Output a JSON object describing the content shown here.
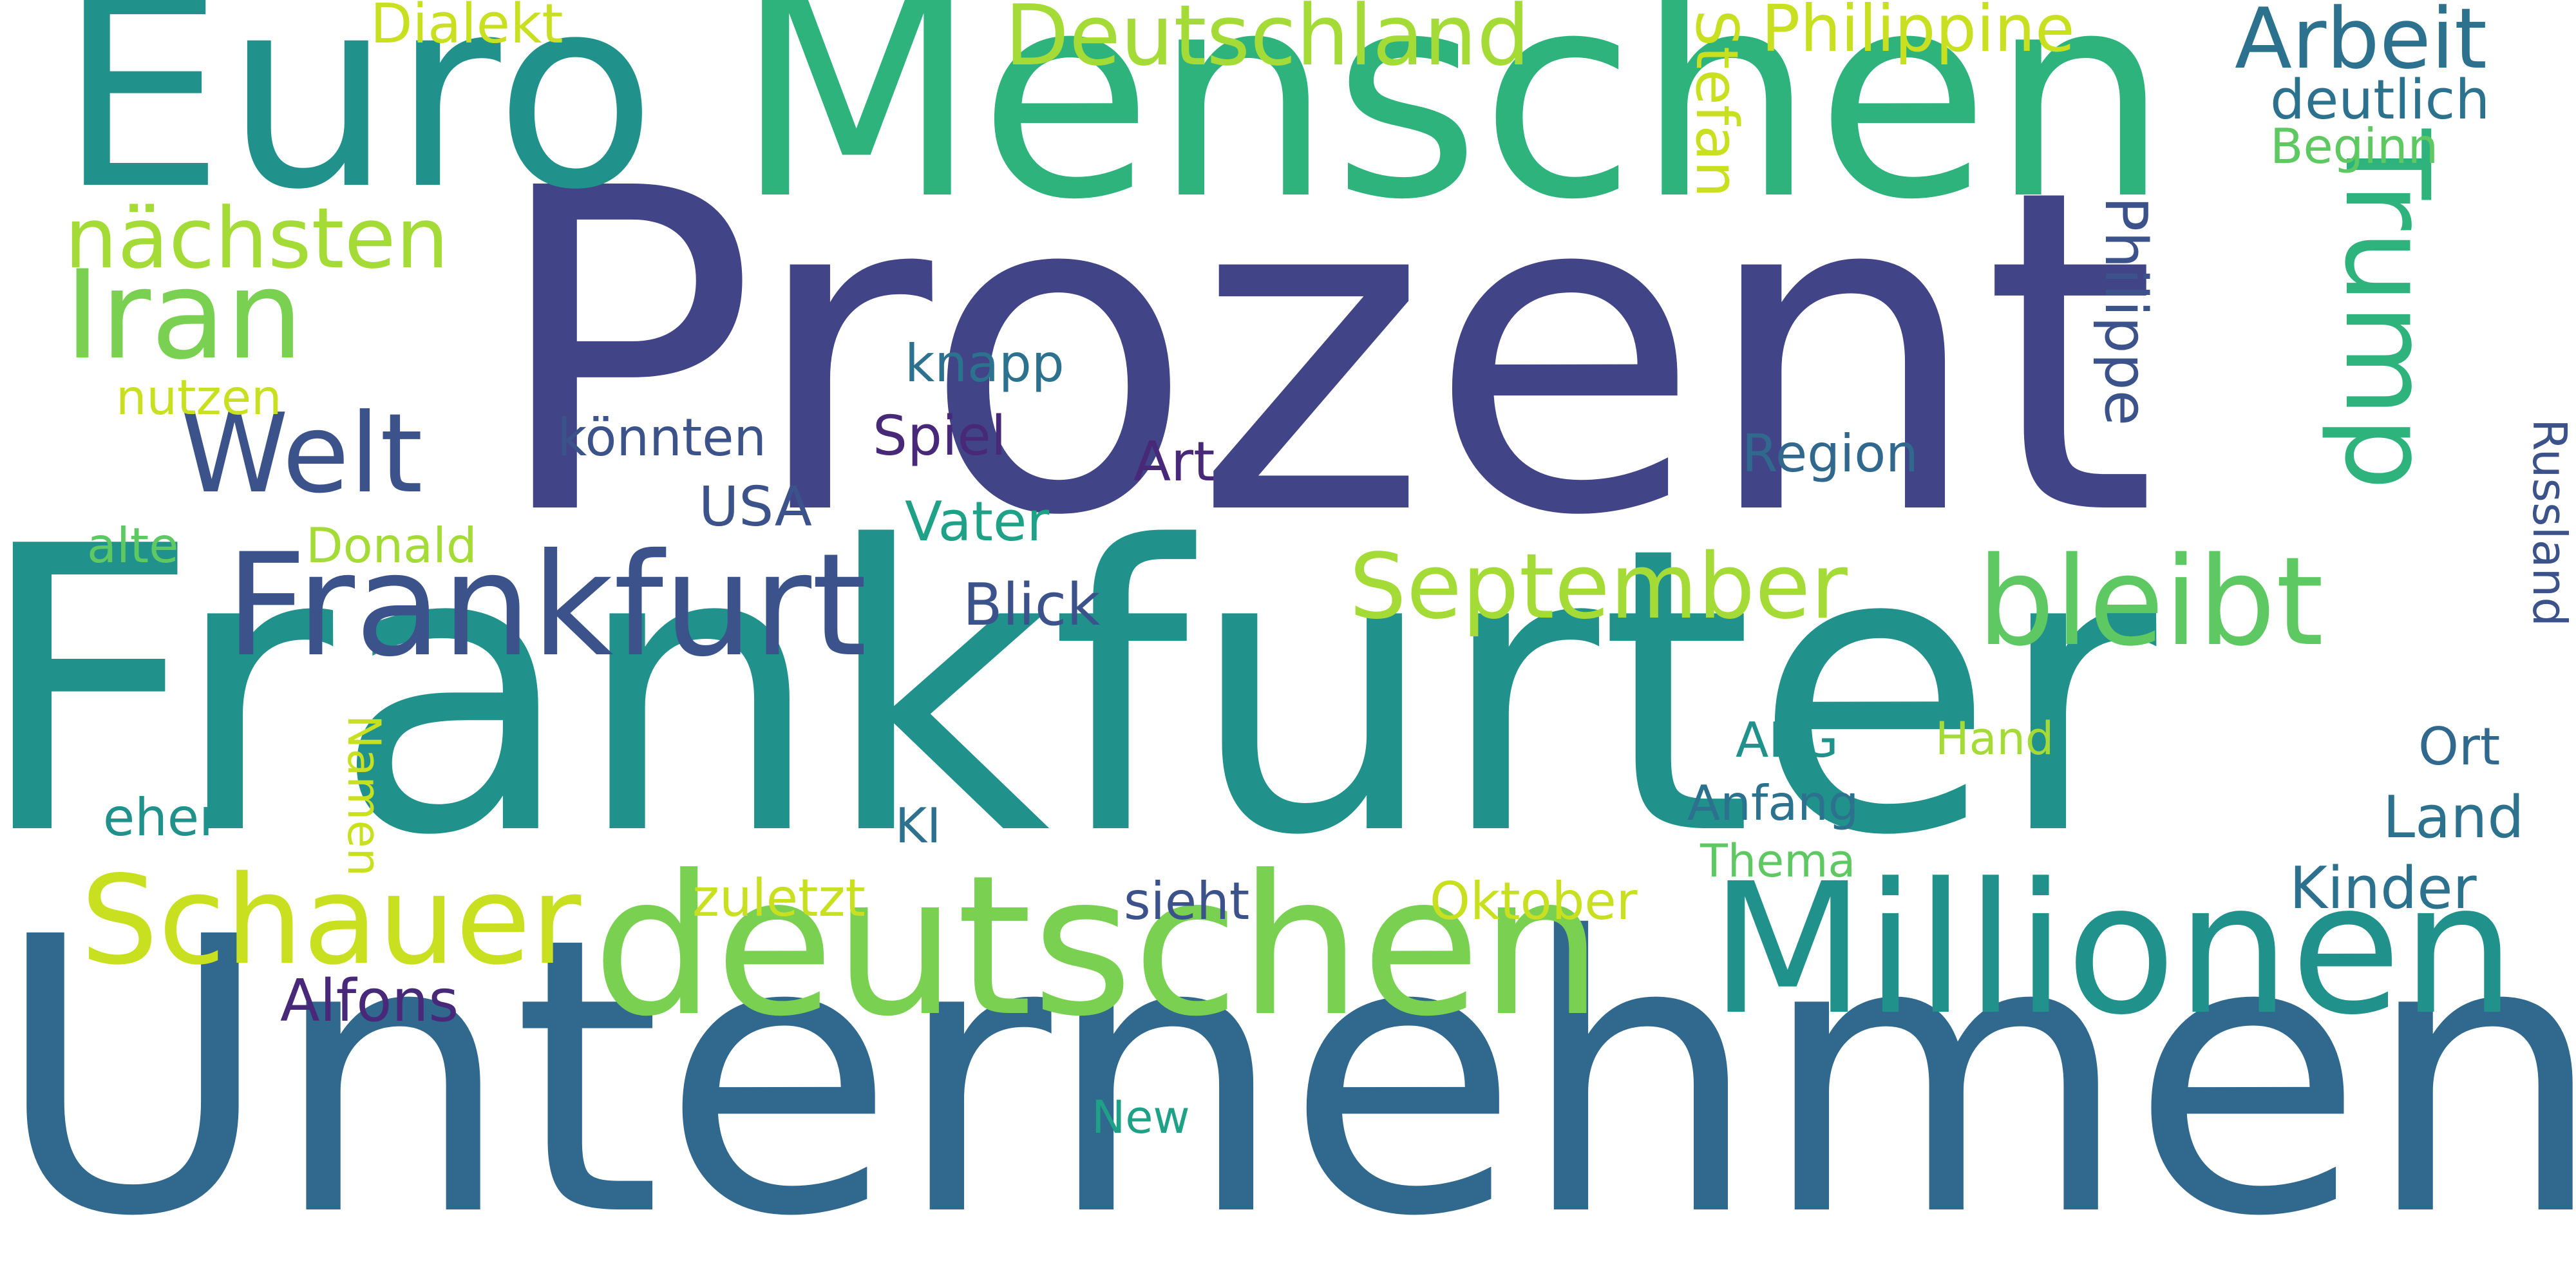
{
  "words": [
    {
      "text": "Prozent",
      "color": "#414487"
    },
    {
      "text": "Frankfurter",
      "color": "#21918C"
    },
    {
      "text": "Unternehmen",
      "color": "#31688E"
    },
    {
      "text": "Menschen",
      "color": "#2EB37C"
    },
    {
      "text": "Euro",
      "color": "#21918C"
    },
    {
      "text": "deutschen",
      "color": "#7AD151"
    },
    {
      "text": "Millionen",
      "color": "#21918C"
    },
    {
      "text": "Frankfurt",
      "color": "#3B528B"
    },
    {
      "text": "Schauer",
      "color": "#C8E020"
    },
    {
      "text": "bleibt",
      "color": "#5EC962"
    },
    {
      "text": "September",
      "color": "#A5DB36"
    },
    {
      "text": "Trump",
      "color": "#2EB37C"
    },
    {
      "text": "Iran",
      "color": "#7AD151"
    },
    {
      "text": "Welt",
      "color": "#3B528B"
    },
    {
      "text": "Deutschland",
      "color": "#A5DB36"
    },
    {
      "text": "Arbeit",
      "color": "#2C728E"
    },
    {
      "text": "nächsten",
      "color": "#A5DB36"
    },
    {
      "text": "Philippine",
      "color": "#C8E020"
    },
    {
      "text": "Philippe",
      "color": "#3B528B"
    },
    {
      "text": "Stefan",
      "color": "#C8E020"
    },
    {
      "text": "Dialekt",
      "color": "#C8E020"
    },
    {
      "text": "deutlich",
      "color": "#2C728E"
    },
    {
      "text": "Beginn",
      "color": "#5EC962"
    },
    {
      "text": "Russland",
      "color": "#3B528B"
    },
    {
      "text": "knapp",
      "color": "#2C728E"
    },
    {
      "text": "könnten",
      "color": "#3B528B"
    },
    {
      "text": "Spiel",
      "color": "#482878"
    },
    {
      "text": "Art",
      "color": "#482878"
    },
    {
      "text": "Region",
      "color": "#31688E"
    },
    {
      "text": "nutzen",
      "color": "#C8E020"
    },
    {
      "text": "USA",
      "color": "#3B528B"
    },
    {
      "text": "Vater",
      "color": "#1FA187"
    },
    {
      "text": "Donald",
      "color": "#A5DB36"
    },
    {
      "text": "alte",
      "color": "#5EC962"
    },
    {
      "text": "Blick",
      "color": "#3B528B"
    },
    {
      "text": "ABG",
      "color": "#21918C"
    },
    {
      "text": "Hand",
      "color": "#A5DB36"
    },
    {
      "text": "Ort",
      "color": "#31688E"
    },
    {
      "text": "Anfang",
      "color": "#2C728E"
    },
    {
      "text": "Land",
      "color": "#2C728E"
    },
    {
      "text": "Namen",
      "color": "#C8E020"
    },
    {
      "text": "eher",
      "color": "#21918C"
    },
    {
      "text": "KI",
      "color": "#2C728E"
    },
    {
      "text": "Thema",
      "color": "#5EC962"
    },
    {
      "text": "zuletzt",
      "color": "#C8E020"
    },
    {
      "text": "sieht",
      "color": "#3B528B"
    },
    {
      "text": "Oktober",
      "color": "#C8E020"
    },
    {
      "text": "Kinder",
      "color": "#2C728E"
    },
    {
      "text": "Alfons",
      "color": "#482878"
    },
    {
      "text": "New",
      "color": "#1FA187"
    }
  ]
}
